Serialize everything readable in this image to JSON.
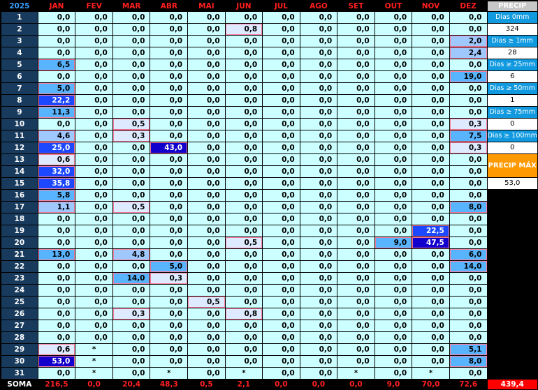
{
  "year": "2025",
  "months": [
    "JAN",
    "FEV",
    "MAR",
    "ABR",
    "MAI",
    "JUN",
    "JUL",
    "AGO",
    "SET",
    "OUT",
    "NOV",
    "DEZ"
  ],
  "days": [
    "1",
    "2",
    "3",
    "4",
    "5",
    "6",
    "7",
    "8",
    "9",
    "10",
    "11",
    "12",
    "13",
    "14",
    "15",
    "16",
    "17",
    "18",
    "19",
    "20",
    "21",
    "22",
    "23",
    "24",
    "25",
    "26",
    "27",
    "28",
    "29",
    "30",
    "31"
  ],
  "values": [
    [
      "0,0",
      "0,0",
      "0,0",
      "0,0",
      "0,0",
      "0,0",
      "0,0",
      "0,0",
      "0,0",
      "0,0",
      "0,0",
      "0,0"
    ],
    [
      "0,0",
      "0,0",
      "0,0",
      "0,0",
      "0,0",
      "0,8",
      "0,0",
      "0,0",
      "0,0",
      "0,0",
      "0,0",
      "0,0"
    ],
    [
      "0,0",
      "0,0",
      "0,0",
      "0,0",
      "0,0",
      "0,0",
      "0,0",
      "0,0",
      "0,0",
      "0,0",
      "0,0",
      "2,0"
    ],
    [
      "0,0",
      "0,0",
      "0,0",
      "0,0",
      "0,0",
      "0,0",
      "0,0",
      "0,0",
      "0,0",
      "0,0",
      "0,0",
      "2,4"
    ],
    [
      "6,5",
      "0,0",
      "0,0",
      "0,0",
      "0,0",
      "0,0",
      "0,0",
      "0,0",
      "0,0",
      "0,0",
      "0,0",
      "0,0"
    ],
    [
      "0,0",
      "0,0",
      "0,0",
      "0,0",
      "0,0",
      "0,0",
      "0,0",
      "0,0",
      "0,0",
      "0,0",
      "0,0",
      "19,0"
    ],
    [
      "5,0",
      "0,0",
      "0,0",
      "0,0",
      "0,0",
      "0,0",
      "0,0",
      "0,0",
      "0,0",
      "0,0",
      "0,0",
      "0,0"
    ],
    [
      "22,2",
      "0,0",
      "0,0",
      "0,0",
      "0,0",
      "0,0",
      "0,0",
      "0,0",
      "0,0",
      "0,0",
      "0,0",
      "0,0"
    ],
    [
      "11,3",
      "0,0",
      "0,0",
      "0,0",
      "0,0",
      "0,0",
      "0,0",
      "0,0",
      "0,0",
      "0,0",
      "0,0",
      "0,0"
    ],
    [
      "0,0",
      "0,0",
      "0,5",
      "0,0",
      "0,0",
      "0,0",
      "0,0",
      "0,0",
      "0,0",
      "0,0",
      "0,0",
      "0,3"
    ],
    [
      "4,6",
      "0,0",
      "0,3",
      "0,0",
      "0,0",
      "0,0",
      "0,0",
      "0,0",
      "0,0",
      "0,0",
      "0,0",
      "7,5"
    ],
    [
      "25,0",
      "0,0",
      "0,0",
      "43,0",
      "0,0",
      "0,0",
      "0,0",
      "0,0",
      "0,0",
      "0,0",
      "0,0",
      "0,3"
    ],
    [
      "0,6",
      "0,0",
      "0,0",
      "0,0",
      "0,0",
      "0,0",
      "0,0",
      "0,0",
      "0,0",
      "0,0",
      "0,0",
      "0,0"
    ],
    [
      "32,0",
      "0,0",
      "0,0",
      "0,0",
      "0,0",
      "0,0",
      "0,0",
      "0,0",
      "0,0",
      "0,0",
      "0,0",
      "0,0"
    ],
    [
      "35,8",
      "0,0",
      "0,0",
      "0,0",
      "0,0",
      "0,0",
      "0,0",
      "0,0",
      "0,0",
      "0,0",
      "0,0",
      "0,0"
    ],
    [
      "5,8",
      "0,0",
      "0,0",
      "0,0",
      "0,0",
      "0,0",
      "0,0",
      "0,0",
      "0,0",
      "0,0",
      "0,0",
      "0,0"
    ],
    [
      "1,1",
      "0,0",
      "0,5",
      "0,0",
      "0,0",
      "0,0",
      "0,0",
      "0,0",
      "0,0",
      "0,0",
      "0,0",
      "8,0"
    ],
    [
      "0,0",
      "0,0",
      "0,0",
      "0,0",
      "0,0",
      "0,0",
      "0,0",
      "0,0",
      "0,0",
      "0,0",
      "0,0",
      "0,0"
    ],
    [
      "0,0",
      "0,0",
      "0,0",
      "0,0",
      "0,0",
      "0,0",
      "0,0",
      "0,0",
      "0,0",
      "0,0",
      "22,5",
      "0,0"
    ],
    [
      "0,0",
      "0,0",
      "0,0",
      "0,0",
      "0,0",
      "0,5",
      "0,0",
      "0,0",
      "0,0",
      "9,0",
      "47,5",
      "0,0"
    ],
    [
      "13,0",
      "0,0",
      "4,8",
      "0,0",
      "0,0",
      "0,0",
      "0,0",
      "0,0",
      "0,0",
      "0,0",
      "0,0",
      "6,0"
    ],
    [
      "0,0",
      "0,0",
      "0,0",
      "5,0",
      "0,0",
      "0,0",
      "0,0",
      "0,0",
      "0,0",
      "0,0",
      "0,0",
      "14,0"
    ],
    [
      "0,0",
      "0,0",
      "14,0",
      "0,3",
      "0,0",
      "0,0",
      "0,0",
      "0,0",
      "0,0",
      "0,0",
      "0,0",
      "0,0"
    ],
    [
      "0,0",
      "0,0",
      "0,0",
      "0,0",
      "0,0",
      "0,0",
      "0,0",
      "0,0",
      "0,0",
      "0,0",
      "0,0",
      "0,0"
    ],
    [
      "0,0",
      "0,0",
      "0,0",
      "0,0",
      "0,5",
      "0,0",
      "0,0",
      "0,0",
      "0,0",
      "0,0",
      "0,0",
      "0,0"
    ],
    [
      "0,0",
      "0,0",
      "0,3",
      "0,0",
      "0,0",
      "0,8",
      "0,0",
      "0,0",
      "0,0",
      "0,0",
      "0,0",
      "0,0"
    ],
    [
      "0,0",
      "0,0",
      "0,0",
      "0,0",
      "0,0",
      "0,0",
      "0,0",
      "0,0",
      "0,0",
      "0,0",
      "0,0",
      "0,0"
    ],
    [
      "0,0",
      "0,0",
      "0,0",
      "0,0",
      "0,0",
      "0,0",
      "0,0",
      "0,0",
      "0,0",
      "0,0",
      "0,0",
      "0,0"
    ],
    [
      "0,6",
      "*",
      "0,0",
      "0,0",
      "0,0",
      "0,0",
      "0,0",
      "0,0",
      "0,0",
      "0,0",
      "0,0",
      "5,1"
    ],
    [
      "53,0",
      "*",
      "0,0",
      "0,0",
      "0,0",
      "0,0",
      "0,0",
      "0,0",
      "0,0",
      "0,0",
      "0,0",
      "8,0"
    ],
    [
      "0,0",
      "*",
      "0,0",
      "*",
      "0,0",
      "*",
      "0,0",
      "0,0",
      "*",
      "0,0",
      "*",
      "0,0"
    ]
  ],
  "sum_label": "SOMA",
  "sums": [
    "216,5",
    "0,0",
    "20,4",
    "48,3",
    "0,5",
    "2,1",
    "0,0",
    "0,0",
    "0,0",
    "9,0",
    "70,0",
    "72,6"
  ],
  "total": "439,4",
  "side_panel": {
    "precip_header": "PRECIP",
    "stats": [
      {
        "label": "Dias 0mm",
        "value": "324"
      },
      {
        "label": "Dias ≥ 1mm",
        "value": "28"
      },
      {
        "label": "Dias ≥ 25mm",
        "value": "6"
      },
      {
        "label": "Dias ≥ 50mm",
        "value": "1"
      },
      {
        "label": "Dias ≥ 75mm",
        "value": "0"
      },
      {
        "label": "Dias ≥ 100mm",
        "value": "0"
      }
    ],
    "max_header": "PRECIP MÁX",
    "max_value": "53,0"
  },
  "colors": {
    "header_text": "#ff1e1e",
    "year_text": "#3aa0ff",
    "cell_bg": "#ccffff",
    "row_number_bg": "#183a5c",
    "stat_label_bg": "#129ae0",
    "max_header_bg": "#ff9900",
    "total_bg": "#ff0000"
  }
}
